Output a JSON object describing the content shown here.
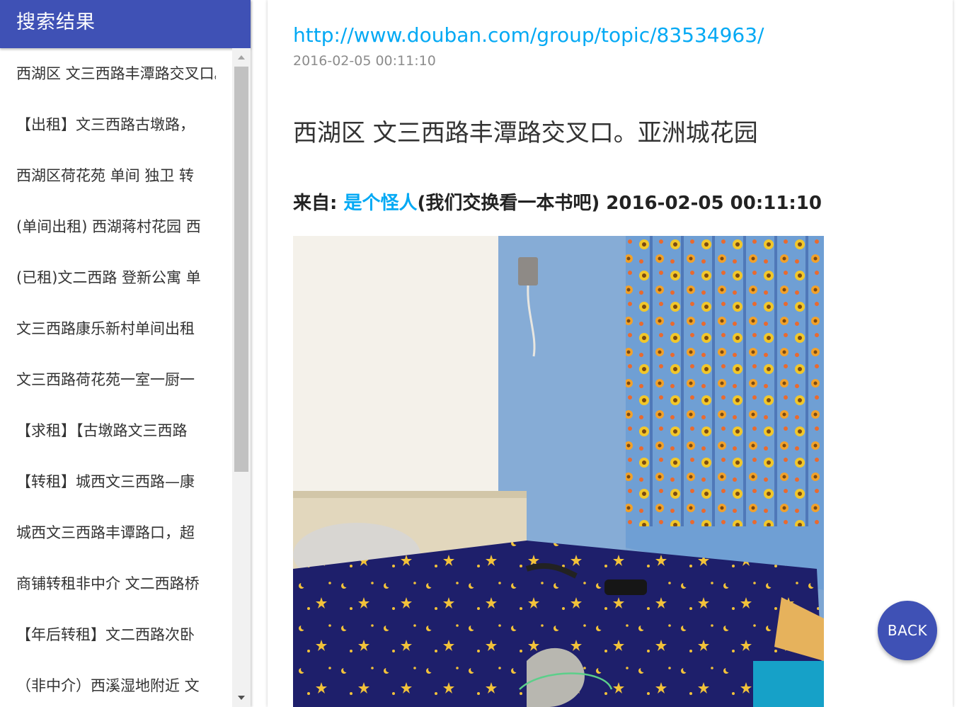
{
  "sidebar": {
    "title": "搜索结果",
    "items": [
      {
        "label": "西湖区 文三西路丰潭路交叉口。亚洲城花园"
      },
      {
        "label": "【出租】文三西路古墩路，"
      },
      {
        "label": "西湖区荷花苑 单间 独卫 转"
      },
      {
        "label": "(单间出租) 西湖蒋村花园 西"
      },
      {
        "label": "(已租)文二西路 登新公寓 单"
      },
      {
        "label": "文三西路康乐新村单间出租"
      },
      {
        "label": "文三西路荷花苑一室一厨一"
      },
      {
        "label": "【求租】【古墩路文三西路"
      },
      {
        "label": "【转租】城西文三西路—康"
      },
      {
        "label": "城西文三西路丰谭路口，超"
      },
      {
        "label": "商铺转租非中介 文二西路桥"
      },
      {
        "label": "【年后转租】文二西路次卧"
      },
      {
        "label": "（非中介）西溪湿地附近 文"
      }
    ]
  },
  "post": {
    "url": "http://www.douban.com/group/topic/83534963/",
    "timestamp": "2016-02-05 00:11:10",
    "title": "西湖区 文三西路丰潭路交叉口。亚洲城花园",
    "byline_prefix": "来自: ",
    "author": "是个怪人",
    "byline_suffix": "(我们交换看一本书吧) 2016-02-05 00:11:10"
  },
  "back_button": {
    "label": "BACK"
  },
  "colors": {
    "primary": "#3f51b5",
    "link": "#03a9f4"
  }
}
